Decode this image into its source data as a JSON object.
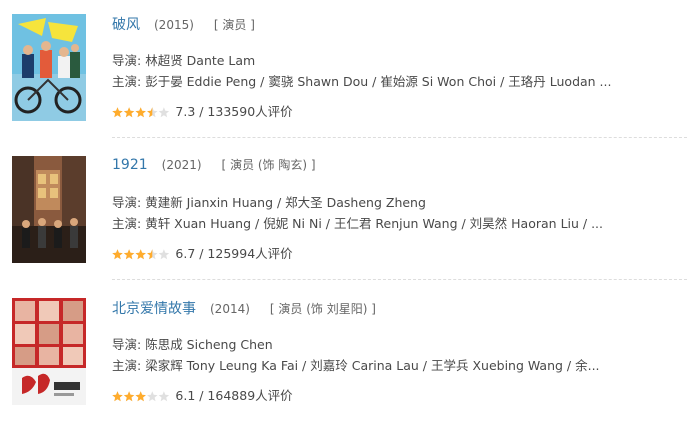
{
  "movies": [
    {
      "title": "破风",
      "year": "(2015)",
      "role_open": "[",
      "role": "演员",
      "role_close": "]",
      "director_label": "导演: ",
      "directors": "林超贤 Dante Lam",
      "cast_label": "主演: ",
      "cast": "彭于晏 Eddie Peng / 窦骁 Shawn Dou / 崔始源 Si Won Choi / 王珞丹 Luodan ...",
      "stars": 3.5,
      "rating_text": "7.3 / 133590人评价",
      "poster_icon": "movie-poster",
      "colors": {
        "primary": "#6ab7d9",
        "secondary": "#f2e33b"
      }
    },
    {
      "title": "1921",
      "year": "(2021)",
      "role_open": "[",
      "role": "演员 (饰 陶玄)",
      "role_close": "]",
      "director_label": "导演: ",
      "directors": "黄建新 Jianxin Huang / 郑大圣 Dasheng Zheng",
      "cast_label": "主演: ",
      "cast": "黄轩 Xuan Huang / 倪妮 Ni Ni / 王仁君 Renjun Wang / 刘昊然 Haoran Liu / ...",
      "stars": 3.5,
      "rating_text": "6.7 / 125994人评价",
      "poster_icon": "movie-poster",
      "colors": {
        "primary": "#a0684a",
        "secondary": "#3b2a20"
      }
    },
    {
      "title": "北京爱情故事",
      "year": "(2014)",
      "role_open": "[",
      "role": "演员 (饰 刘星阳)",
      "role_close": "]",
      "director_label": "导演: ",
      "directors": "陈思成 Sicheng Chen",
      "cast_label": "主演: ",
      "cast": "梁家辉 Tony Leung Ka Fai / 刘嘉玲 Carina Lau / 王学兵 Xuebing Wang / 余...",
      "stars": 3,
      "rating_text": "6.1 / 164889人评价",
      "poster_icon": "movie-poster",
      "colors": {
        "primary": "#c62828",
        "secondary": "#f5f5f5"
      }
    }
  ],
  "accent_colors": {
    "link": "#3377aa",
    "star": "#ffac2d",
    "star_empty": "#e0e0e0"
  }
}
